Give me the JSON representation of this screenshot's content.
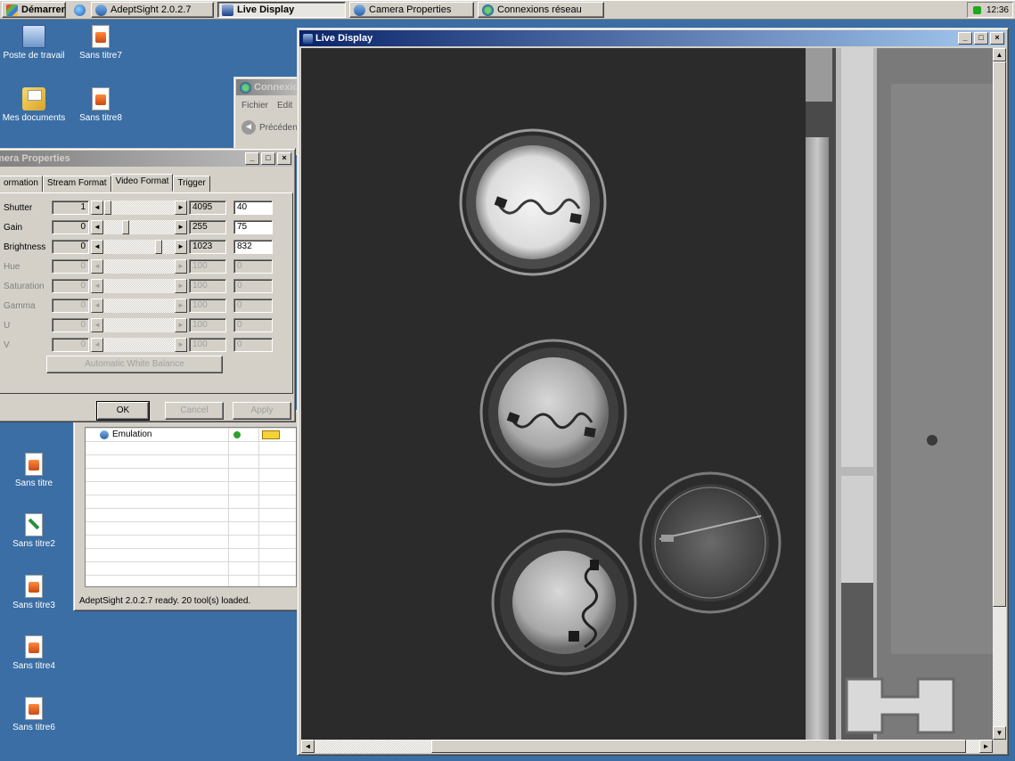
{
  "taskbar": {
    "start_label": "Démarrer",
    "tasks": [
      {
        "label": "AdeptSight 2.0.2.7",
        "icon": "adeptsight-icon"
      },
      {
        "label": "Live Display",
        "icon": "live-display-icon",
        "active": true
      },
      {
        "label": "Camera Properties",
        "icon": "camera-properties-icon"
      },
      {
        "label": "Connexions réseau",
        "icon": "network-connections-icon"
      }
    ],
    "clock": "12:36"
  },
  "desktop": {
    "icons": [
      {
        "label": "Poste de travail",
        "icon": "my-computer-icon"
      },
      {
        "label": "Sans titre7",
        "icon": "document-icon"
      },
      {
        "label": "Mes documents",
        "icon": "my-documents-icon"
      },
      {
        "label": "Sans titre8",
        "icon": "document-icon"
      },
      {
        "label": "Sans titre",
        "icon": "document-icon"
      },
      {
        "label": "Sans titre2",
        "icon": "paint-document-icon"
      },
      {
        "label": "Sans titre3",
        "icon": "document-icon"
      },
      {
        "label": "Sans titre4",
        "icon": "document-icon"
      },
      {
        "label": "Sans titre6",
        "icon": "document-icon"
      }
    ]
  },
  "connexions_window": {
    "title": "Connexion",
    "menu": [
      "Fichier",
      "Edit"
    ],
    "back_label": "Précéden"
  },
  "camera_properties": {
    "title": "mera Properties",
    "tabs": [
      "ormation",
      "Stream Format",
      "Video Format",
      "Trigger"
    ],
    "active_tab": "Video Format",
    "properties": [
      {
        "name": "Shutter",
        "min": "1",
        "max": "4095",
        "value": "40",
        "enabled": true,
        "level": 0.01
      },
      {
        "name": "Gain",
        "min": "0",
        "max": "255",
        "value": "75",
        "enabled": true,
        "level": 0.29
      },
      {
        "name": "Brightness",
        "min": "0",
        "max": "1023",
        "value": "832",
        "enabled": true,
        "level": 0.81
      },
      {
        "name": "Hue",
        "min": "0",
        "max": "100",
        "value": "0",
        "enabled": false,
        "level": 0
      },
      {
        "name": "Saturation",
        "min": "0",
        "max": "100",
        "value": "0",
        "enabled": false,
        "level": 0
      },
      {
        "name": "Gamma",
        "min": "0",
        "max": "100",
        "value": "0",
        "enabled": false,
        "level": 0
      },
      {
        "name": "U",
        "min": "0",
        "max": "100",
        "value": "0",
        "enabled": false,
        "level": 0
      },
      {
        "name": "V",
        "min": "0",
        "max": "100",
        "value": "0",
        "enabled": false,
        "level": 0
      }
    ],
    "white_balance_label": "Automatic White Balance",
    "ok_label": "OK",
    "cancel_label": "Cancel",
    "apply_label": "Apply"
  },
  "adeptsight": {
    "grid_first_row": "Emulation",
    "status": "AdeptSight 2.0.2.7 ready. 20 tool(s) loaded."
  },
  "live_display": {
    "title": "Live Display",
    "scroll_up": "▲",
    "scroll_down": "▼",
    "scroll_left": "◄",
    "scroll_right": "►"
  },
  "colors": {
    "desktop": "#3a6ea5",
    "active_title_start": "#0a246a",
    "active_title_end": "#a6caf0",
    "window_face": "#d4d0c8"
  }
}
